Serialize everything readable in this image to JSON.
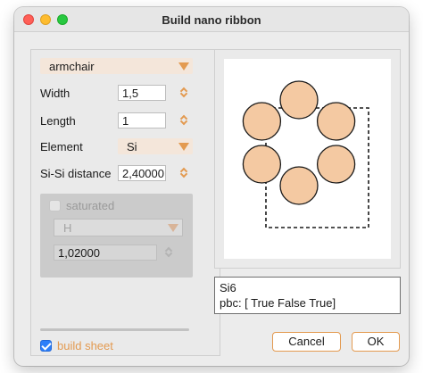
{
  "window": {
    "title": "Build nano ribbon"
  },
  "form": {
    "ribbon_type": "armchair",
    "width": {
      "label": "Width",
      "value": "1,5"
    },
    "length": {
      "label": "Length",
      "value": "1"
    },
    "element": {
      "label": "Element",
      "value": "Si"
    },
    "bond_distance": {
      "label": "Si-Si distance",
      "value": "2,40000"
    },
    "saturated": {
      "label": "saturated",
      "checked": false,
      "element": "H",
      "distance": "1,02000"
    },
    "build_sheet": {
      "label": "build sheet",
      "checked": true
    }
  },
  "preview": {
    "atom_count": 6,
    "atom_fill": "#f4c9a2",
    "atom_stroke": "#1a1a1a"
  },
  "info": {
    "line1": "Si6",
    "line2": "pbc: [ True False  True]"
  },
  "buttons": {
    "cancel": "Cancel",
    "ok": "OK"
  },
  "colors": {
    "accent": "#e39a50",
    "checkbox_on": "#2d7ff9"
  }
}
